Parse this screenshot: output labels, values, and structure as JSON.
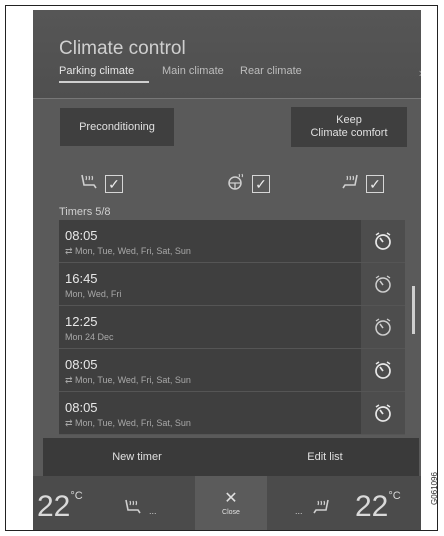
{
  "header": {
    "title": "Climate control",
    "tabs": [
      {
        "label": "Parking climate"
      },
      {
        "label": "Main climate"
      },
      {
        "label": "Rear climate"
      }
    ],
    "chevron": "›"
  },
  "buttons": {
    "preconditioning": "Preconditioning",
    "keep_line1": "Keep",
    "keep_line2": "Climate comfort"
  },
  "seat_options": [
    {
      "icon": "heated-seat-icon",
      "checked": true,
      "check": "✓"
    },
    {
      "icon": "heated-steering-icon",
      "checked": true,
      "check": "✓"
    },
    {
      "icon": "heated-rear-seat-icon",
      "checked": true,
      "check": "✓"
    }
  ],
  "timers": {
    "label": "Timers 5/8",
    "items": [
      {
        "time": "08:05",
        "days": "⇄ Mon, Tue, Wed, Fri, Sat, Sun"
      },
      {
        "time": "16:45",
        "days": "Mon, Wed, Fri"
      },
      {
        "time": "12:25",
        "days": "Mon 24 Dec"
      },
      {
        "time": "08:05",
        "days": "⇄ Mon, Tue, Wed, Fri, Sat, Sun"
      },
      {
        "time": "08:05",
        "days": "⇄ Mon, Tue, Wed, Fri, Sat, Sun"
      }
    ]
  },
  "bottom_actions": {
    "new_timer": "New timer",
    "edit_list": "Edit list"
  },
  "footer": {
    "left_temp": "22",
    "right_temp": "22",
    "unit": "°C",
    "close_label": "Close",
    "close_glyph": "✕",
    "dots": "..."
  },
  "image_code": "G061096"
}
